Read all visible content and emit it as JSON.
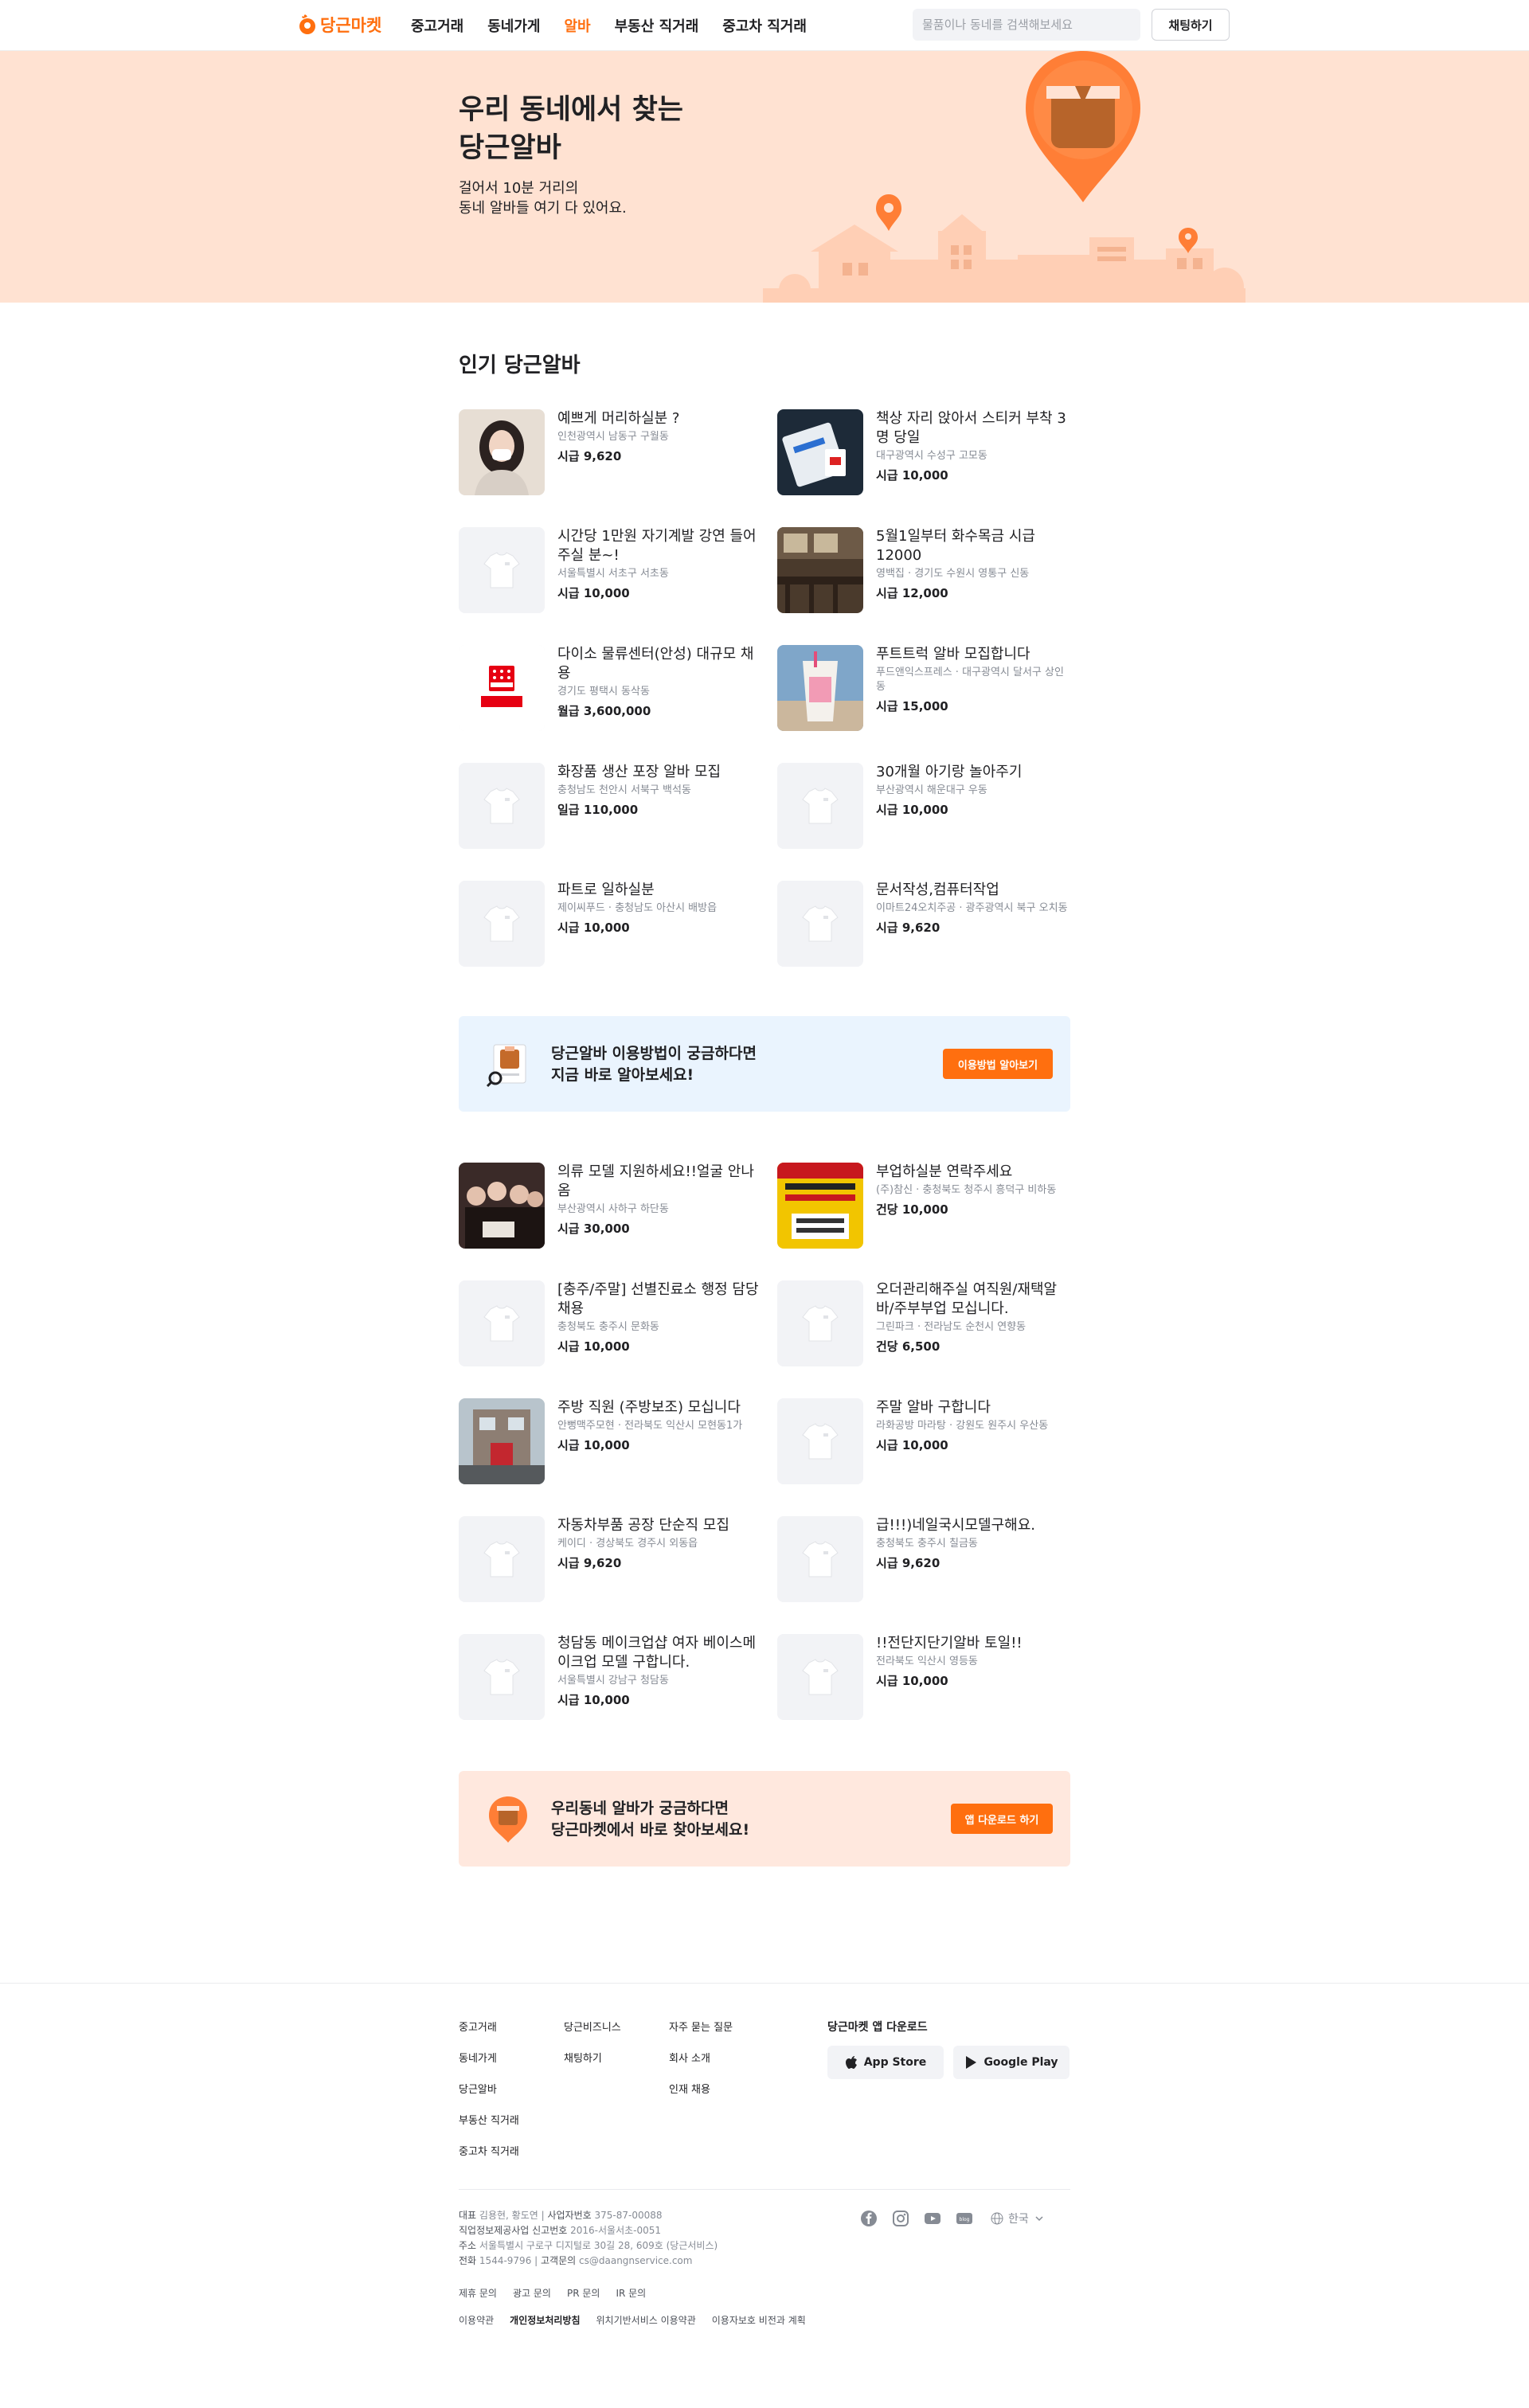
{
  "header": {
    "logo_text": "당근마켓",
    "nav": [
      "중고거래",
      "동네가게",
      "알바",
      "부동산 직거래",
      "중고차 직거래"
    ],
    "active_nav": 2,
    "search_placeholder": "물품이나 동네를 검색해보세요",
    "chat_button": "채팅하기"
  },
  "hero": {
    "title_line1": "우리 동네에서 찾는",
    "title_line2": "당근알바",
    "sub_line1": "걸어서 10분 거리의",
    "sub_line2": "동네 알바들 여기 다 있어요."
  },
  "section_title": "인기 당근알바",
  "jobs_1": [
    {
      "title": "예쁘게 머리하실분 ?",
      "location": "인천광역시 남동구 구월동",
      "pay": "시급 9,620",
      "thumb": "photo-woman"
    },
    {
      "title": "책상 자리 앉아서 스티커 부착 3명 당일",
      "location": "대구광역시 수성구 고모동",
      "pay": "시급 10,000",
      "thumb": "photo-sticker"
    },
    {
      "title": "시간당 1만원 자기계발 강연 들어주실 분~!",
      "location": "서울특별시 서초구 서초동",
      "pay": "시급 10,000",
      "thumb": "placeholder"
    },
    {
      "title": "5월1일부터 화수목금 시급12000",
      "location": "영백집 · 경기도 수원시 영통구 신동",
      "pay": "시급 12,000",
      "thumb": "photo-cafe"
    },
    {
      "title": "다이소 물류센터(안성) 대규모 채용",
      "location": "경기도 평택시 동삭동",
      "pay": "월급 3,600,000",
      "thumb": "daiso"
    },
    {
      "title": "푸트트럭 알바 모집합니다",
      "location": "푸드앤익스프레스 · 대구광역시 달서구 상인동",
      "pay": "시급 15,000",
      "thumb": "photo-drink"
    },
    {
      "title": "화장품 생산 포장 알바 모집",
      "location": "충청남도 천안시 서북구 백석동",
      "pay": "일급 110,000",
      "thumb": "placeholder"
    },
    {
      "title": "30개월 아기랑 놀아주기",
      "location": "부산광역시 해운대구 우동",
      "pay": "시급 10,000",
      "thumb": "placeholder"
    },
    {
      "title": "파트로 일하실분",
      "location": "제이씨푸드 · 충청남도 아산시 배방읍",
      "pay": "시급 10,000",
      "thumb": "placeholder"
    },
    {
      "title": "문서작성,컴퓨터작업",
      "location": "이마트24오치주공 · 광주광역시 북구 오치동",
      "pay": "시급 9,620",
      "thumb": "placeholder"
    }
  ],
  "banner_1": {
    "line1": "당근알바 이용방법이 궁금하다면",
    "line2": "지금 바로 알아보세요!",
    "button": "이용방법 알아보기"
  },
  "jobs_2": [
    {
      "title": "의류 모델 지원하세요!!얼굴 안나옴",
      "location": "부산광역시 사하구 하단동",
      "pay": "시급 30,000",
      "thumb": "photo-group"
    },
    {
      "title": "부업하실분 연락주세요",
      "location": "(주)참신 · 충청북도 청주시 흥덕구 비하동",
      "pay": "건당 10,000",
      "thumb": "photo-sign"
    },
    {
      "title": "[충주/주말] 선별진료소 행정 담당채용",
      "location": "충청북도 충주시 문화동",
      "pay": "시급 10,000",
      "thumb": "placeholder"
    },
    {
      "title": "오더관리해주실 여직원/재택알바/주부부업 모십니다.",
      "location": "그린파크 · 전라남도 순천시 연향동",
      "pay": "건당 6,500",
      "thumb": "placeholder"
    },
    {
      "title": "주방 직원 (주방보조) 모십니다",
      "location": "안뻥맥주모현 · 전라북도 익산시 모현동1가",
      "pay": "시급 10,000",
      "thumb": "photo-street"
    },
    {
      "title": "주말 알바 구합니다",
      "location": "라화공방 마라탕 · 강원도 원주시 우산동",
      "pay": "시급 10,000",
      "thumb": "placeholder"
    },
    {
      "title": "자동차부품 공장 단순직 모집",
      "location": "케이디 · 경상북도 경주시 외동읍",
      "pay": "시급 9,620",
      "thumb": "placeholder"
    },
    {
      "title": "급!!!)네일국시모델구해요.",
      "location": "충청북도 충주시 칠금동",
      "pay": "시급 9,620",
      "thumb": "placeholder"
    },
    {
      "title": "청담동 메이크업샵 여자 베이스메이크업 모델 구합니다.",
      "location": "서울특별시 강남구 청담동",
      "pay": "시급 10,000",
      "thumb": "placeholder"
    },
    {
      "title": "!!전단지단기알바 토일!!",
      "location": "전라북도 익산시 영등동",
      "pay": "시급 10,000",
      "thumb": "placeholder"
    }
  ],
  "banner_2": {
    "line1": "우리동네 알바가 궁금하다면",
    "line2": "당근마켓에서 바로 찾아보세요!",
    "button": "앱 다운로드 하기"
  },
  "footer": {
    "col1": [
      "중고거래",
      "동네가게",
      "당근알바",
      "부동산 직거래",
      "중고차 직거래"
    ],
    "col2": [
      "당근비즈니스",
      "채팅하기"
    ],
    "col3": [
      "자주 묻는 질문",
      "회사 소개",
      "인재 채용"
    ],
    "app_title": "당근마켓 앱 다운로드",
    "app_store": "App Store",
    "google_play": "Google Play",
    "info_line1_label": "대표",
    "info_line1": "김용현, 황도연",
    "info_line1_label2": "사업자번호",
    "info_line1_value2": "375-87-00088",
    "info_line2_label": "직업정보제공사업 신고번호",
    "info_line2": "2016-서울서초-0051",
    "info_line3_label": "주소",
    "info_line3": "서울특별시 구로구 디지털로 30길 28, 609호 (당근서비스)",
    "info_line4_label": "전화",
    "info_line4": "1544-9796",
    "info_line4_label2": "고객문의",
    "info_line4_value2": "cs@daangnservice.com",
    "links_row1": [
      "제휴 문의",
      "광고 문의",
      "PR 문의",
      "IR 문의"
    ],
    "links_row2": [
      "이용약관",
      "개인정보처리방침",
      "위치기반서비스 이용약관",
      "이용자보호 비전과 계획"
    ],
    "language": "한국",
    "blog_label": "blog"
  },
  "colors": {
    "brand": "#ff6f0f",
    "hero_bg": "#ffe2d2",
    "banner_blue": "#eaf4fe",
    "banner_peach": "#ffe8de"
  }
}
